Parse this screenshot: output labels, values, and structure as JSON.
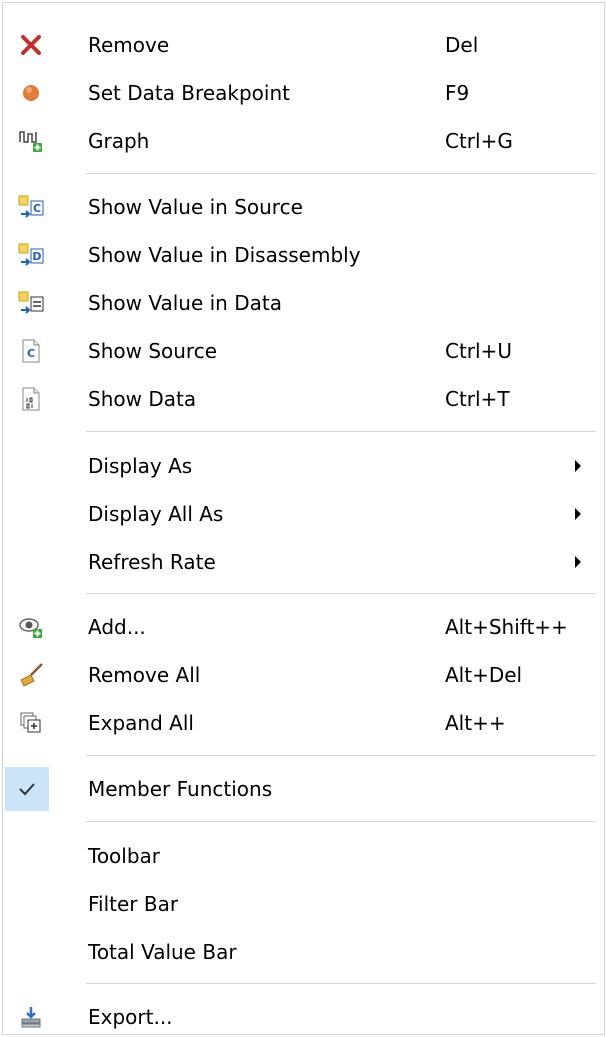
{
  "menu": {
    "items": [
      {
        "label": "Remove",
        "shortcut": "Del",
        "icon": "remove-x-icon"
      },
      {
        "label": "Set Data Breakpoint",
        "shortcut": "F9",
        "icon": "breakpoint-icon"
      },
      {
        "label": "Graph",
        "shortcut": "Ctrl+G",
        "icon": "graph-add-icon"
      },
      {
        "label": "Show Value in Source",
        "shortcut": "",
        "icon": "show-value-source-icon"
      },
      {
        "label": "Show Value in Disassembly",
        "shortcut": "",
        "icon": "show-value-disassembly-icon"
      },
      {
        "label": "Show Value in Data",
        "shortcut": "",
        "icon": "show-value-data-icon"
      },
      {
        "label": "Show Source",
        "shortcut": "Ctrl+U",
        "icon": "source-file-icon"
      },
      {
        "label": "Show Data",
        "shortcut": "Ctrl+T",
        "icon": "data-file-icon"
      },
      {
        "label": "Display As",
        "shortcut": "",
        "icon": ""
      },
      {
        "label": "Display All As",
        "shortcut": "",
        "icon": ""
      },
      {
        "label": "Refresh Rate",
        "shortcut": "",
        "icon": ""
      },
      {
        "label": "Add...",
        "shortcut": "Alt+Shift++",
        "icon": "watch-add-icon"
      },
      {
        "label": "Remove All",
        "shortcut": "Alt+Del",
        "icon": "broom-icon"
      },
      {
        "label": "Expand All",
        "shortcut": "Alt++",
        "icon": "expand-all-icon"
      },
      {
        "label": "Member Functions",
        "shortcut": "",
        "icon": "checkmark-icon"
      },
      {
        "label": "Toolbar",
        "shortcut": "",
        "icon": ""
      },
      {
        "label": "Filter Bar",
        "shortcut": "",
        "icon": ""
      },
      {
        "label": "Total Value Bar",
        "shortcut": "",
        "icon": ""
      },
      {
        "label": "Export...",
        "shortcut": "",
        "icon": "export-icon"
      }
    ],
    "member_functions_checked": true,
    "colors": {
      "check_highlight": "#cce4f7",
      "remove_red": "#c0312b",
      "breakpoint_orange": "#e07b3a",
      "add_green": "#3aa83a",
      "separator": "#d8d8d8"
    }
  }
}
